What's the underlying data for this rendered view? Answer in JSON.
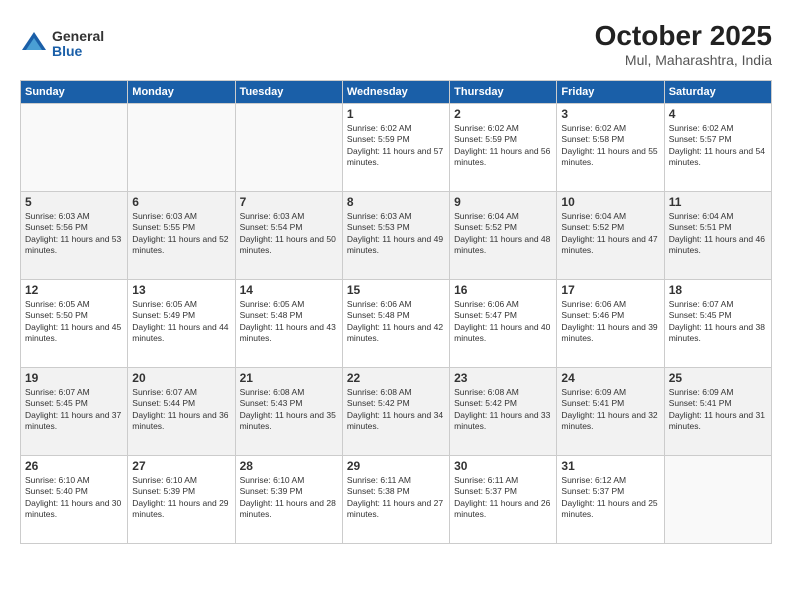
{
  "logo": {
    "general": "General",
    "blue": "Blue"
  },
  "title": "October 2025",
  "location": "Mul, Maharashtra, India",
  "weekdays": [
    "Sunday",
    "Monday",
    "Tuesday",
    "Wednesday",
    "Thursday",
    "Friday",
    "Saturday"
  ],
  "weeks": [
    [
      {
        "day": "",
        "sunrise": "",
        "sunset": "",
        "daylight": ""
      },
      {
        "day": "",
        "sunrise": "",
        "sunset": "",
        "daylight": ""
      },
      {
        "day": "",
        "sunrise": "",
        "sunset": "",
        "daylight": ""
      },
      {
        "day": "1",
        "sunrise": "Sunrise: 6:02 AM",
        "sunset": "Sunset: 5:59 PM",
        "daylight": "Daylight: 11 hours and 57 minutes."
      },
      {
        "day": "2",
        "sunrise": "Sunrise: 6:02 AM",
        "sunset": "Sunset: 5:59 PM",
        "daylight": "Daylight: 11 hours and 56 minutes."
      },
      {
        "day": "3",
        "sunrise": "Sunrise: 6:02 AM",
        "sunset": "Sunset: 5:58 PM",
        "daylight": "Daylight: 11 hours and 55 minutes."
      },
      {
        "day": "4",
        "sunrise": "Sunrise: 6:02 AM",
        "sunset": "Sunset: 5:57 PM",
        "daylight": "Daylight: 11 hours and 54 minutes."
      }
    ],
    [
      {
        "day": "5",
        "sunrise": "Sunrise: 6:03 AM",
        "sunset": "Sunset: 5:56 PM",
        "daylight": "Daylight: 11 hours and 53 minutes."
      },
      {
        "day": "6",
        "sunrise": "Sunrise: 6:03 AM",
        "sunset": "Sunset: 5:55 PM",
        "daylight": "Daylight: 11 hours and 52 minutes."
      },
      {
        "day": "7",
        "sunrise": "Sunrise: 6:03 AM",
        "sunset": "Sunset: 5:54 PM",
        "daylight": "Daylight: 11 hours and 50 minutes."
      },
      {
        "day": "8",
        "sunrise": "Sunrise: 6:03 AM",
        "sunset": "Sunset: 5:53 PM",
        "daylight": "Daylight: 11 hours and 49 minutes."
      },
      {
        "day": "9",
        "sunrise": "Sunrise: 6:04 AM",
        "sunset": "Sunset: 5:52 PM",
        "daylight": "Daylight: 11 hours and 48 minutes."
      },
      {
        "day": "10",
        "sunrise": "Sunrise: 6:04 AM",
        "sunset": "Sunset: 5:52 PM",
        "daylight": "Daylight: 11 hours and 47 minutes."
      },
      {
        "day": "11",
        "sunrise": "Sunrise: 6:04 AM",
        "sunset": "Sunset: 5:51 PM",
        "daylight": "Daylight: 11 hours and 46 minutes."
      }
    ],
    [
      {
        "day": "12",
        "sunrise": "Sunrise: 6:05 AM",
        "sunset": "Sunset: 5:50 PM",
        "daylight": "Daylight: 11 hours and 45 minutes."
      },
      {
        "day": "13",
        "sunrise": "Sunrise: 6:05 AM",
        "sunset": "Sunset: 5:49 PM",
        "daylight": "Daylight: 11 hours and 44 minutes."
      },
      {
        "day": "14",
        "sunrise": "Sunrise: 6:05 AM",
        "sunset": "Sunset: 5:48 PM",
        "daylight": "Daylight: 11 hours and 43 minutes."
      },
      {
        "day": "15",
        "sunrise": "Sunrise: 6:06 AM",
        "sunset": "Sunset: 5:48 PM",
        "daylight": "Daylight: 11 hours and 42 minutes."
      },
      {
        "day": "16",
        "sunrise": "Sunrise: 6:06 AM",
        "sunset": "Sunset: 5:47 PM",
        "daylight": "Daylight: 11 hours and 40 minutes."
      },
      {
        "day": "17",
        "sunrise": "Sunrise: 6:06 AM",
        "sunset": "Sunset: 5:46 PM",
        "daylight": "Daylight: 11 hours and 39 minutes."
      },
      {
        "day": "18",
        "sunrise": "Sunrise: 6:07 AM",
        "sunset": "Sunset: 5:45 PM",
        "daylight": "Daylight: 11 hours and 38 minutes."
      }
    ],
    [
      {
        "day": "19",
        "sunrise": "Sunrise: 6:07 AM",
        "sunset": "Sunset: 5:45 PM",
        "daylight": "Daylight: 11 hours and 37 minutes."
      },
      {
        "day": "20",
        "sunrise": "Sunrise: 6:07 AM",
        "sunset": "Sunset: 5:44 PM",
        "daylight": "Daylight: 11 hours and 36 minutes."
      },
      {
        "day": "21",
        "sunrise": "Sunrise: 6:08 AM",
        "sunset": "Sunset: 5:43 PM",
        "daylight": "Daylight: 11 hours and 35 minutes."
      },
      {
        "day": "22",
        "sunrise": "Sunrise: 6:08 AM",
        "sunset": "Sunset: 5:42 PM",
        "daylight": "Daylight: 11 hours and 34 minutes."
      },
      {
        "day": "23",
        "sunrise": "Sunrise: 6:08 AM",
        "sunset": "Sunset: 5:42 PM",
        "daylight": "Daylight: 11 hours and 33 minutes."
      },
      {
        "day": "24",
        "sunrise": "Sunrise: 6:09 AM",
        "sunset": "Sunset: 5:41 PM",
        "daylight": "Daylight: 11 hours and 32 minutes."
      },
      {
        "day": "25",
        "sunrise": "Sunrise: 6:09 AM",
        "sunset": "Sunset: 5:41 PM",
        "daylight": "Daylight: 11 hours and 31 minutes."
      }
    ],
    [
      {
        "day": "26",
        "sunrise": "Sunrise: 6:10 AM",
        "sunset": "Sunset: 5:40 PM",
        "daylight": "Daylight: 11 hours and 30 minutes."
      },
      {
        "day": "27",
        "sunrise": "Sunrise: 6:10 AM",
        "sunset": "Sunset: 5:39 PM",
        "daylight": "Daylight: 11 hours and 29 minutes."
      },
      {
        "day": "28",
        "sunrise": "Sunrise: 6:10 AM",
        "sunset": "Sunset: 5:39 PM",
        "daylight": "Daylight: 11 hours and 28 minutes."
      },
      {
        "day": "29",
        "sunrise": "Sunrise: 6:11 AM",
        "sunset": "Sunset: 5:38 PM",
        "daylight": "Daylight: 11 hours and 27 minutes."
      },
      {
        "day": "30",
        "sunrise": "Sunrise: 6:11 AM",
        "sunset": "Sunset: 5:37 PM",
        "daylight": "Daylight: 11 hours and 26 minutes."
      },
      {
        "day": "31",
        "sunrise": "Sunrise: 6:12 AM",
        "sunset": "Sunset: 5:37 PM",
        "daylight": "Daylight: 11 hours and 25 minutes."
      },
      {
        "day": "",
        "sunrise": "",
        "sunset": "",
        "daylight": ""
      }
    ]
  ]
}
